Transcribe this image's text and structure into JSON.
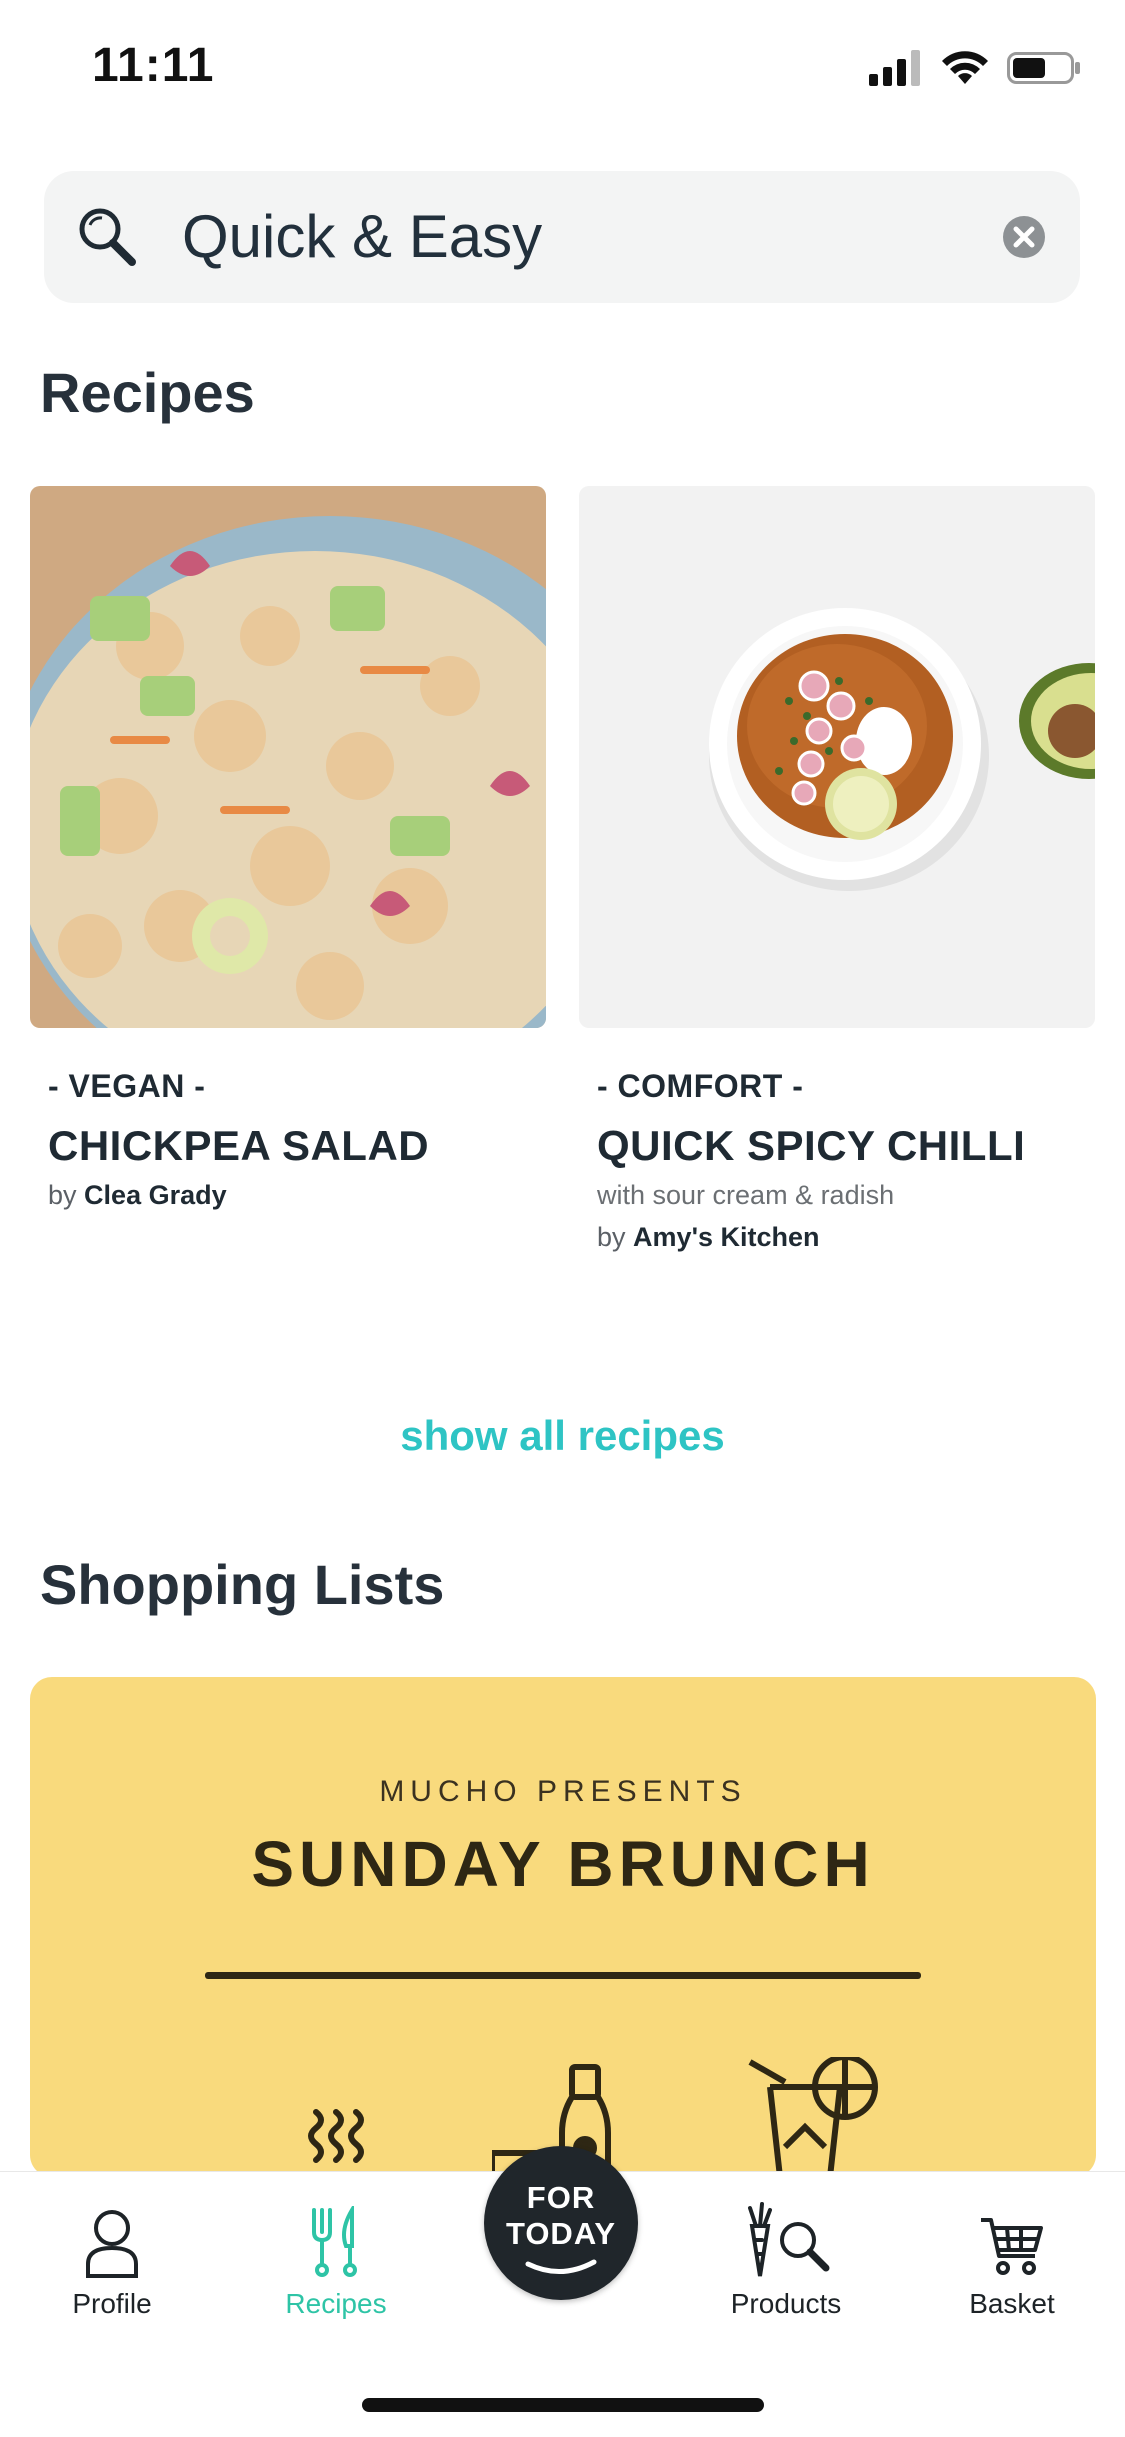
{
  "status_bar": {
    "time": "11:11"
  },
  "search": {
    "query": "Quick & Easy"
  },
  "recipes_section": {
    "title": "Recipes",
    "cards": [
      {
        "tag": "- VEGAN -",
        "title": "CHICKPEA SALAD",
        "subtitle": "",
        "by": "by",
        "author": "Clea Grady"
      },
      {
        "tag": "- COMFORT -",
        "title": "QUICK SPICY CHILLI",
        "subtitle": "with sour cream & radish",
        "by": "by",
        "author": "Amy's Kitchen"
      }
    ],
    "show_all": "show all recipes"
  },
  "shopping_section": {
    "title": "Shopping Lists",
    "banner": {
      "pre_title": "MUCHO PRESENTS",
      "title": "SUNDAY BRUNCH"
    }
  },
  "bottom_nav": {
    "items": [
      {
        "label": "Profile",
        "icon": "profile-icon"
      },
      {
        "label": "Recipes",
        "icon": "fork-knife-icon",
        "active": true
      },
      {
        "label": "FOR TODAY",
        "icon": "for-today-badge"
      },
      {
        "label": "Products",
        "icon": "carrot-search-icon"
      },
      {
        "label": "Basket",
        "icon": "cart-icon"
      }
    ],
    "for_today_line1": "FOR",
    "for_today_line2": "TODAY"
  },
  "colors": {
    "accent": "#2ec4c4",
    "nav_active": "#2ec4a6",
    "banner": "#f9da7d",
    "text": "#22303c"
  }
}
